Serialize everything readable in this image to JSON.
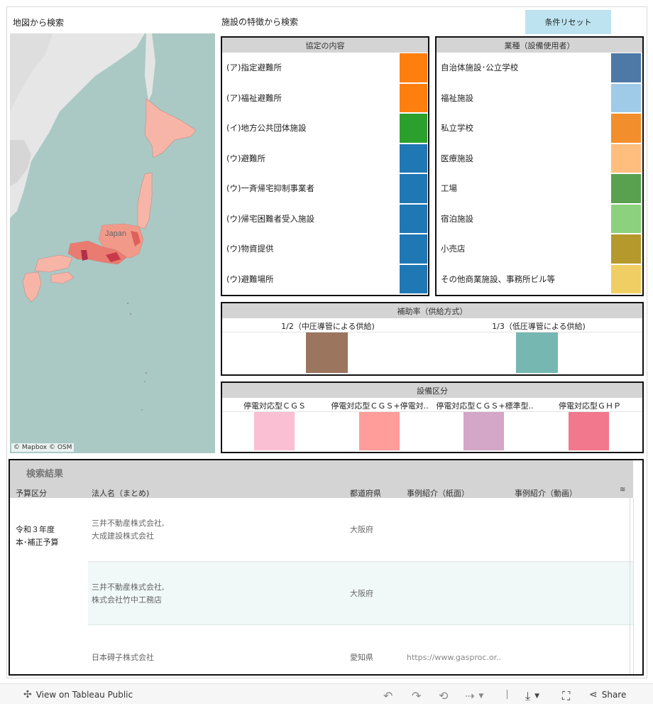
{
  "map": {
    "title": "地図から検索",
    "label": "Japan",
    "attribution": "© Mapbox © OSM"
  },
  "features": {
    "title": "施設の特徴から検索",
    "reset_label": "条件リセット"
  },
  "agreement": {
    "header": "協定の内容",
    "items": [
      {
        "label": "(ア)指定避難所",
        "color": "#ff7f0e"
      },
      {
        "label": "(ア)福祉避難所",
        "color": "#ff7f0e"
      },
      {
        "label": "(イ)地方公共団体施設",
        "color": "#2ca02c"
      },
      {
        "label": "(ウ)避難所",
        "color": "#1f77b4"
      },
      {
        "label": "(ウ)一斉帰宅抑制事業者",
        "color": "#1f77b4"
      },
      {
        "label": "(ウ)帰宅困難者受入施設",
        "color": "#1f77b4"
      },
      {
        "label": "(ウ)物資提供",
        "color": "#1f77b4"
      },
      {
        "label": "(ウ)避難場所",
        "color": "#1f77b4"
      }
    ]
  },
  "industry": {
    "header": "業種（設備使用者）",
    "items": [
      {
        "label": "自治体施設･公立学校",
        "color": "#4e79a7"
      },
      {
        "label": "福祉施設",
        "color": "#a0cbe8"
      },
      {
        "label": "私立学校",
        "color": "#f28e2b"
      },
      {
        "label": "医療施設",
        "color": "#ffbe7d"
      },
      {
        "label": "工場",
        "color": "#59a14f"
      },
      {
        "label": "宿泊施設",
        "color": "#8cd17d"
      },
      {
        "label": "小売店",
        "color": "#b6992d"
      },
      {
        "label": "その他商業施設、事務所ビル等",
        "color": "#f1ce63"
      }
    ]
  },
  "subsidy": {
    "header": "補助率（供給方式）",
    "items": [
      {
        "label": "1/2（中圧導管による供給)",
        "color": "#9c755f"
      },
      {
        "label": "1/3（低圧導管による供給)",
        "color": "#76b7b2"
      }
    ]
  },
  "equipment": {
    "header": "設備区分",
    "items": [
      {
        "label": "停電対応型ＣＧＳ",
        "color": "#fabfd2"
      },
      {
        "label": "停電対応型ＣＧＳ+停電対..",
        "color": "#ff9d9a"
      },
      {
        "label": "停電対応型ＣＧＳ+標準型..",
        "color": "#d4a6c8"
      },
      {
        "label": "停電対応型ＧＨＰ",
        "color": "#f1788d"
      }
    ]
  },
  "results": {
    "title": "検索結果",
    "columns": [
      "予算区分",
      "法人名（まとめ)",
      "都道府県",
      "事例紹介（紙面）",
      "事例紹介（動画）"
    ],
    "sort_icon": "sort-icon",
    "budget_group_line1": "令和３年度",
    "budget_group_line2": "本･補正予算",
    "rows": [
      {
        "name_line1": "三井不動産株式会社,",
        "name_line2": "大成建設株式会社",
        "pref": "大阪府",
        "paper": "",
        "video": ""
      },
      {
        "name_line1": "三井不動産株式会社,",
        "name_line2": "株式会社竹中工務店",
        "pref": "大阪府",
        "paper": "",
        "video": ""
      },
      {
        "name_line1": "日本碍子株式会社",
        "name_line2": "",
        "pref": "愛知県",
        "paper": "https://www.gasproc.or..",
        "video": ""
      }
    ]
  },
  "toolbar": {
    "view_label": "View on Tableau Public",
    "share_label": "Share"
  }
}
